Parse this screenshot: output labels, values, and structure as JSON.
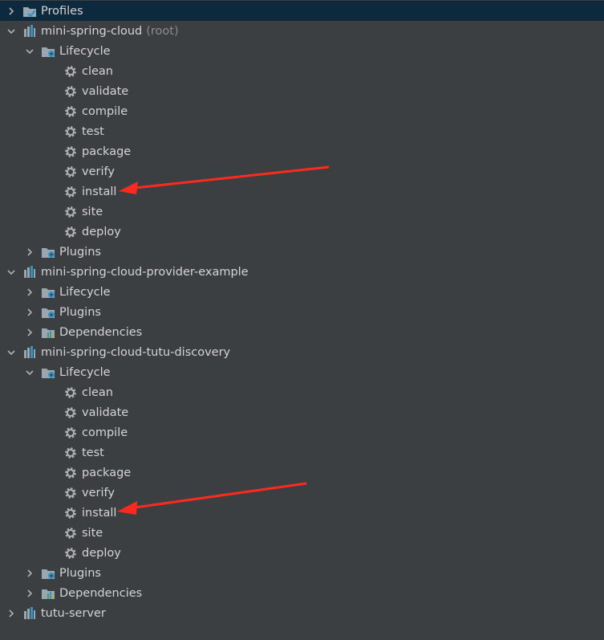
{
  "tree": {
    "profiles": "Profiles",
    "m1": {
      "name": "mini-spring-cloud",
      "suffix": "(root)",
      "lifecycle": "Lifecycle",
      "goals": [
        "clean",
        "validate",
        "compile",
        "test",
        "package",
        "verify",
        "install",
        "site",
        "deploy"
      ],
      "plugins": "Plugins"
    },
    "m2": {
      "name": "mini-spring-cloud-provider-example",
      "lifecycle": "Lifecycle",
      "plugins": "Plugins",
      "dependencies": "Dependencies"
    },
    "m3": {
      "name": "mini-spring-cloud-tutu-discovery",
      "lifecycle": "Lifecycle",
      "goals": [
        "clean",
        "validate",
        "compile",
        "test",
        "package",
        "verify",
        "install",
        "site",
        "deploy"
      ],
      "plugins": "Plugins",
      "dependencies": "Dependencies"
    },
    "m4": {
      "name": "tutu-server"
    }
  },
  "icons": {
    "expanded": "chevron-down-icon",
    "collapsed": "chevron-right-icon",
    "profiles": "profiles-folder-icon",
    "module": "maven-module-icon",
    "lifecycle": "lifecycle-folder-icon",
    "plugins": "plugins-folder-icon",
    "dependencies": "dependencies-folder-icon",
    "goal": "gear-icon",
    "annotation": "red-arrow-annotation"
  },
  "colors": {
    "background": "#3c3f41",
    "selection": "#0d293e",
    "text": "#d4d4d4",
    "muted": "#8c8c8c",
    "arrow": "#ff2a1f"
  }
}
